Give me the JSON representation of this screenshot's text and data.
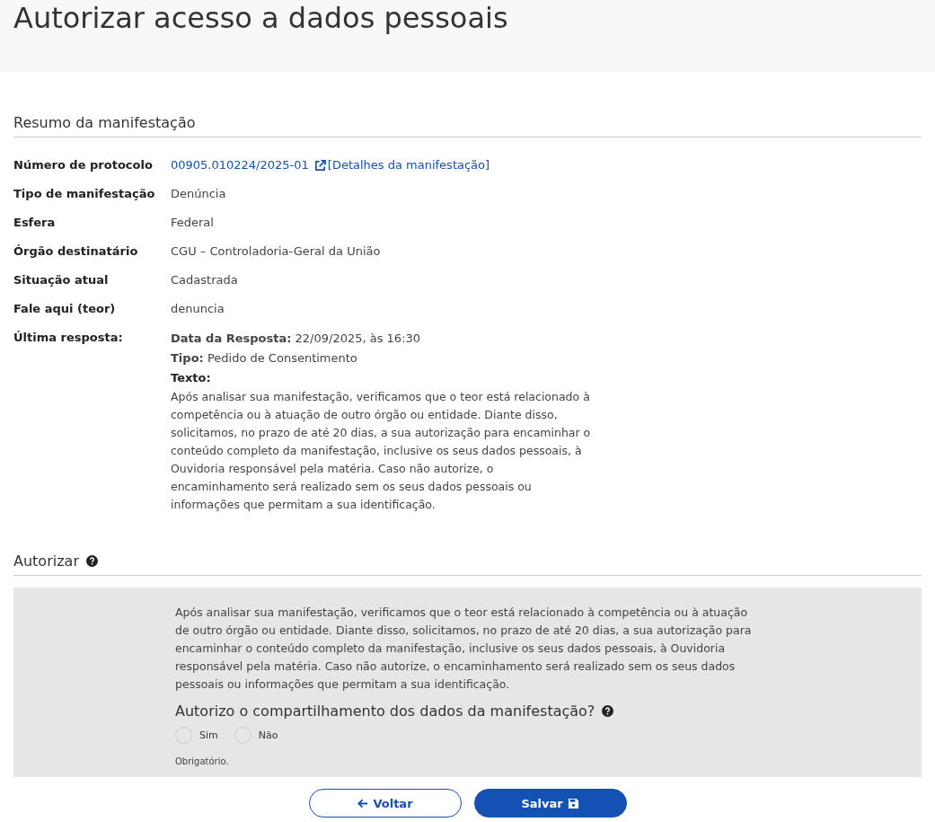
{
  "page_title": "Autorizar acesso a dados pessoais",
  "summary": {
    "heading": "Resumo da manifestação",
    "protocol": {
      "label": "Número de protocolo",
      "number": "00905.010224/2025-01",
      "details_link": "[Detalhes da manifestação]"
    },
    "fields": [
      {
        "label": "Tipo de manifestação",
        "value": "Denúncia"
      },
      {
        "label": "Esfera",
        "value": "Federal"
      },
      {
        "label": "Órgão destinatário",
        "value": "CGU – Controladoria-Geral da União"
      },
      {
        "label": "Situação atual",
        "value": "Cadastrada"
      },
      {
        "label": "Fale aqui (teor)",
        "value": "denuncia"
      }
    ],
    "last_response": {
      "label": "Última resposta:",
      "date": "**Data da Resposta:** 22/09/2025, às 16:30",
      "type": "**Tipo:** Pedido de Consentimento",
      "text_label": "Texto:",
      "text": "Após analisar sua manifestação, verificamos que o teor está relacionado à competência ou à atuação de outro órgão ou entidade. Diante disso, solicitamos, no prazo de até 20 dias, a sua autorização para encaminhar o conteúdo completo da manifestação, inclusive os seus dados pessoais, à Ouvidoria responsável pela matéria. Caso não autorize, o encaminhamento será realizado sem os seus dados pessoais ou informações que permitam a sua identificação."
    }
  },
  "authorize": {
    "heading": "Autorizar",
    "text": "Após analisar sua manifestação, verificamos que o teor está relacionado à competência ou à atuação de outro órgão ou entidade. Diante disso, solicitamos, no prazo de até 20 dias, a sua autorização para encaminhar o conteúdo completo da manifestação, inclusive os seus dados pessoais, à Ouvidoria responsável pela matéria. Caso não autorize, o encaminhamento será realizado sem os seus dados pessoais ou informações que permitam a sua identificação.",
    "question": "Autorizo o compartilhamento dos dados da manifestação?",
    "options": [
      {
        "label": "Sim",
        "selected": false
      },
      {
        "label": "Não",
        "selected": false
      }
    ],
    "required_note": "Obrigatório."
  },
  "buttons": {
    "back": "Voltar",
    "save": "Salvar"
  }
}
